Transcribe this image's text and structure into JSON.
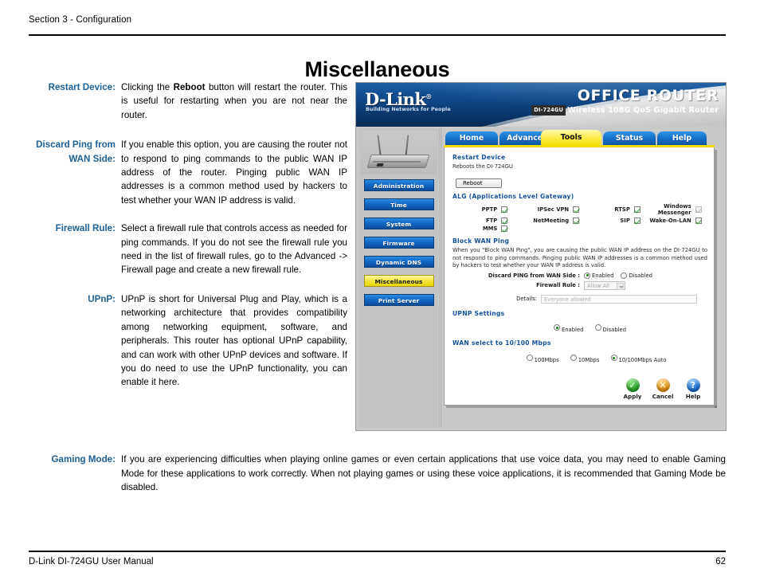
{
  "header": {
    "section": "Section 3 - Configuration",
    "title": "Miscellaneous"
  },
  "definitions": [
    {
      "term": "Restart Device:",
      "desc_pre": "Clicking the ",
      "desc_bold": "Reboot",
      "desc_post": " button will restart the router. This is useful for restarting when you are not near the router."
    },
    {
      "term": "Discard Ping from WAN Side:",
      "desc": "If you enable this option, you are causing the router not to respond to ping commands to the public WAN IP address of the router. Pinging public WAN IP addresses is a common method used by hackers to test whether your WAN IP address is valid."
    },
    {
      "term": "Firewall Rule:",
      "desc": "Select a firewall rule that controls access as needed for ping commands. If you do not see the firewall rule you need in the list of firewall rules, go to the Advanced -> Firewall page and create a new firewall rule."
    },
    {
      "term": "UPnP:",
      "desc": "UPnP is short for Universal Plug and Play, which is a networking architecture that provides compatibility among networking equipment, software, and peripherals. This router has optional UPnP capability, and can work with other UPnP devices and software. If you do need to use the UPnP functionality, you can enable it here."
    }
  ],
  "gaming": {
    "term": "Gaming Mode:",
    "desc": "If you are experiencing difficulties when playing online games or even certain applications that use voice data, you may need to enable Gaming Mode for these applications to work correctly. When not playing games or using these voice applications, it is recommended that Gaming Mode be disabled."
  },
  "footer": {
    "left": "D-Link DI-724GU User Manual",
    "page": "62"
  },
  "screenshot": {
    "brand": "D-Link",
    "brand_tagline": "Building Networks for People",
    "product_title": "OFFICE ROUTER",
    "model_badge": "DI-724GU",
    "product_sub": "Wireless 108G QoS Gigabit Router",
    "nav": [
      {
        "label": "Administration",
        "active": false
      },
      {
        "label": "Time",
        "active": false
      },
      {
        "label": "System",
        "active": false
      },
      {
        "label": "Firmware",
        "active": false
      },
      {
        "label": "Dynamic DNS",
        "active": false
      },
      {
        "label": "Miscellaneous",
        "active": true
      },
      {
        "label": "Print Server",
        "active": false
      }
    ],
    "tabs": [
      {
        "label": "Home",
        "active": false
      },
      {
        "label": "Advanced",
        "active": false
      },
      {
        "label": "Tools",
        "active": true
      },
      {
        "label": "Status",
        "active": false
      },
      {
        "label": "Help",
        "active": false
      }
    ],
    "restart": {
      "heading": "Restart Device",
      "text": "Reboots the DI-724GU",
      "button": "Reboot"
    },
    "alg": {
      "heading": "ALG (Applications Level Gateway)",
      "items": [
        {
          "label": "PPTP",
          "checked": true,
          "dim": false
        },
        {
          "label": "IPSec VPN",
          "checked": true,
          "dim": false
        },
        {
          "label": "RTSP",
          "checked": true,
          "dim": false
        },
        {
          "label": "Windows Messenger",
          "checked": true,
          "dim": true
        },
        {
          "label": "FTP",
          "checked": true,
          "dim": false
        },
        {
          "label": "NetMeeting",
          "checked": true,
          "dim": false
        },
        {
          "label": "SIP",
          "checked": true,
          "dim": false
        },
        {
          "label": "Wake-On-LAN",
          "checked": true,
          "dim": false
        },
        {
          "label": "MMS",
          "checked": true,
          "dim": false
        }
      ]
    },
    "block_wan_ping": {
      "heading": "Block WAN Ping",
      "text": "When you \"Block WAN Ping\", you are causing the public WAN IP address on the DI-724GU to not respond to ping commands. Pinging public WAN IP addresses is a common method used by hackers to test whether your WAN IP address is valid.",
      "discard_label": "Discard PING from WAN Side :",
      "enabled_label": "Enabled",
      "disabled_label": "Disabled",
      "discard_value": "Enabled",
      "firewall_label": "Firewall Rule :",
      "firewall_value": "Allow All",
      "details_label": "Details:",
      "details_value": "Everyone allowed"
    },
    "upnp": {
      "heading": "UPNP Settings",
      "enabled_label": "Enabled",
      "disabled_label": "Disabled",
      "value": "Enabled"
    },
    "wan_select": {
      "heading": "WAN select to 10/100 Mbps",
      "options": [
        "100Mbps",
        "10Mbps",
        "10/100Mbps Auto"
      ],
      "value": "10/100Mbps Auto"
    },
    "actions": [
      {
        "label": "Apply",
        "glyph": "✓",
        "kind": "ok"
      },
      {
        "label": "Cancel",
        "glyph": "✕",
        "kind": "no"
      },
      {
        "label": "Help",
        "glyph": "?",
        "kind": "help"
      }
    ]
  }
}
